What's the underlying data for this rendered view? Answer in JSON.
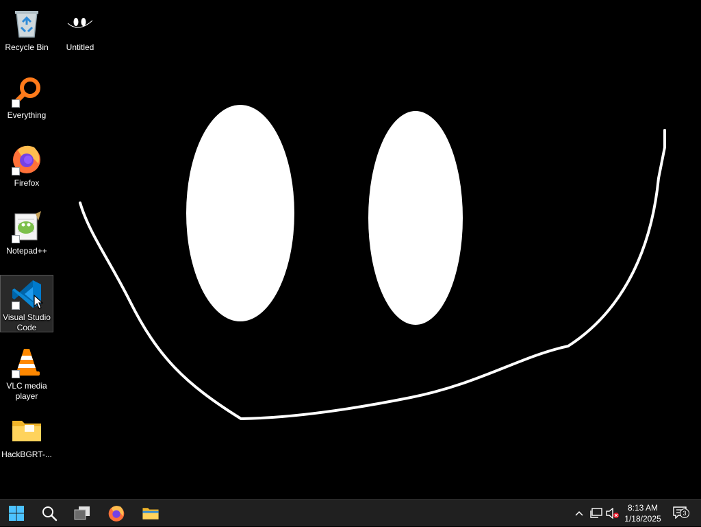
{
  "desktop": {
    "background_color": "#000000",
    "icons": [
      {
        "label": "Recycle Bin",
        "icon": "recycle-bin-icon",
        "shortcut": false
      },
      {
        "label": "Untitled",
        "icon": "untitled-image-icon",
        "shortcut": false
      },
      {
        "label": "Everything",
        "icon": "everything-search-icon",
        "shortcut": true
      },
      {
        "label": "Firefox",
        "icon": "firefox-icon",
        "shortcut": true
      },
      {
        "label": "Notepad++",
        "icon": "notepad-plus-plus-icon",
        "shortcut": true
      },
      {
        "label": "Visual Studio Code",
        "icon": "vscode-icon",
        "shortcut": true,
        "selected": true
      },
      {
        "label": "VLC media player",
        "icon": "vlc-icon",
        "shortcut": true
      },
      {
        "label": "HackBGRT-...",
        "icon": "folder-icon",
        "shortcut": false
      }
    ]
  },
  "taskbar": {
    "background_color": "#202020",
    "buttons": [
      {
        "icon": "windows-start-icon"
      },
      {
        "icon": "search-icon"
      },
      {
        "icon": "task-view-icon"
      },
      {
        "icon": "firefox-icon"
      },
      {
        "icon": "file-explorer-icon"
      }
    ],
    "tray": {
      "icons": [
        "chevron-up-icon",
        "network-icon",
        "volume-muted-icon"
      ],
      "clock": {
        "time": "8:13 AM",
        "date": "1/18/2025"
      },
      "notifications": {
        "icon": "notification-icon",
        "count": "3"
      }
    }
  }
}
